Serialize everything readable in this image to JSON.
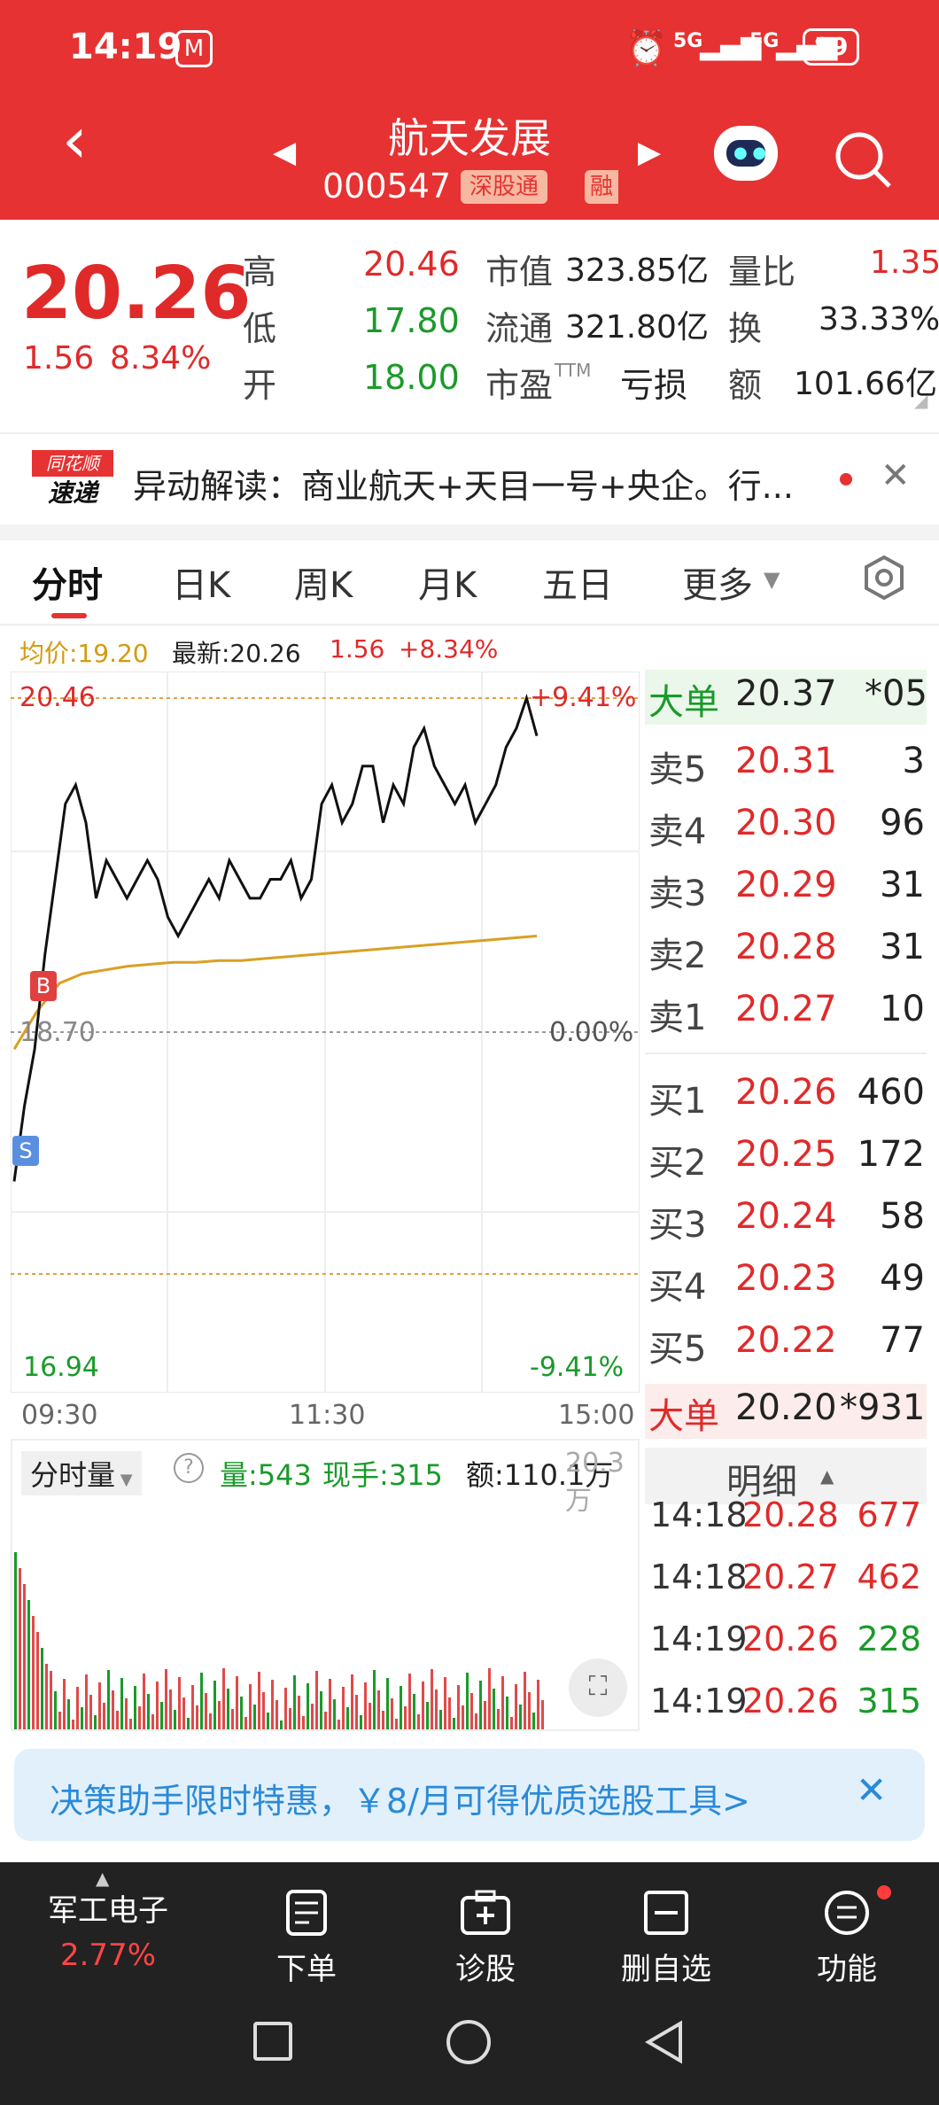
{
  "status": {
    "time": "14:19",
    "signal1": "5G",
    "signal2": "5G",
    "battery": "89"
  },
  "header": {
    "title": "航天发展",
    "code": "000547",
    "badge1": "深股通",
    "badge2": "融"
  },
  "quote": {
    "price": "20.26",
    "change": "1.56",
    "change_pct": "8.34%",
    "high_label": "高",
    "high": "20.46",
    "low_label": "低",
    "low": "17.80",
    "open_label": "开",
    "open": "18.00",
    "mktcap_label": "市值",
    "mktcap": "323.85亿",
    "float_label": "流通",
    "float": "321.80亿",
    "pe_label": "市盈",
    "pe_tm": "TTM",
    "pe": "亏损",
    "volratio_label": "量比",
    "volratio": "1.35",
    "turnover_label": "换",
    "turnover": "33.33%",
    "amount_label": "额",
    "amount": "101.66亿"
  },
  "news": {
    "brand1": "同花顺",
    "brand2": "速递",
    "text": "异动解读：商业航天+天目一号+央企。行..."
  },
  "tabs": [
    "分时",
    "日K",
    "周K",
    "月K",
    "五日",
    "更多"
  ],
  "chart_info": {
    "avg": "均价:19.20",
    "latest": "最新:20.26",
    "chg": "1.56",
    "pct": "+8.34%"
  },
  "chart_labels": {
    "top_price": "20.46",
    "top_pct": "+9.41%",
    "mid_price": "18.70",
    "mid_pct": "0.00%",
    "bot_price": "16.94",
    "bot_pct": "-9.41%",
    "t1": "09:30",
    "t2": "11:30",
    "t3": "15:00",
    "b_marker": "B",
    "s_marker": "S"
  },
  "vol_info": {
    "label": "分时量",
    "vol": "量:543",
    "hand": "现手:315",
    "amt": "额:110.1万",
    "overlay": "20.3万"
  },
  "orderbook": {
    "big_top": {
      "label": "大单",
      "price": "20.37",
      "vol": "*05"
    },
    "asks": [
      {
        "label": "卖5",
        "price": "20.31",
        "vol": "3"
      },
      {
        "label": "卖4",
        "price": "20.30",
        "vol": "96"
      },
      {
        "label": "卖3",
        "price": "20.29",
        "vol": "31"
      },
      {
        "label": "卖2",
        "price": "20.28",
        "vol": "31"
      },
      {
        "label": "卖1",
        "price": "20.27",
        "vol": "10"
      }
    ],
    "bids": [
      {
        "label": "买1",
        "price": "20.26",
        "vol": "460"
      },
      {
        "label": "买2",
        "price": "20.25",
        "vol": "172"
      },
      {
        "label": "买3",
        "price": "20.24",
        "vol": "58"
      },
      {
        "label": "买4",
        "price": "20.23",
        "vol": "49"
      },
      {
        "label": "买5",
        "price": "20.22",
        "vol": "77"
      }
    ],
    "big_bot": {
      "label": "大单",
      "price": "20.20",
      "vol": "*931"
    },
    "detail_label": "明细",
    "ticks": [
      {
        "time": "14:18",
        "price": "20.28",
        "vol": "677"
      },
      {
        "time": "14:18",
        "price": "20.27",
        "vol": "462"
      },
      {
        "time": "14:19",
        "price": "20.26",
        "vol": "228"
      },
      {
        "time": "14:19",
        "price": "20.26",
        "vol": "315"
      }
    ]
  },
  "promo": {
    "text": "决策助手限时特惠，￥8/月可得优质选股工具>"
  },
  "nav": {
    "sector": "军工电子",
    "sector_pct": "2.77%",
    "order": "下单",
    "diag": "诊股",
    "remove": "删自选",
    "func": "功能"
  },
  "chart_data": {
    "type": "line",
    "series": [
      {
        "values": [
          17.9,
          18.3,
          18.6,
          19.1,
          19.5,
          19.9,
          20.0,
          19.8,
          19.4,
          19.6,
          19.5,
          19.4,
          19.5,
          19.6,
          19.5,
          19.3,
          19.2,
          19.3,
          19.4,
          19.5,
          19.4,
          19.6,
          19.5,
          19.4,
          19.4,
          19.5,
          19.5,
          19.6,
          19.4,
          19.5,
          19.9,
          20.0,
          19.8,
          19.9,
          20.1,
          20.1,
          19.8,
          20.0,
          19.9,
          20.2,
          20.3,
          20.1,
          20.0,
          19.9,
          20.0,
          19.8,
          19.9,
          20.0,
          20.2,
          20.3,
          20.46,
          20.26
        ]
      },
      {
        "values": [
          18.6,
          18.8,
          18.95,
          19.0,
          19.02,
          19.04,
          19.05,
          19.06,
          19.06,
          19.07,
          19.07,
          19.08,
          19.09,
          19.1,
          19.11,
          19.12,
          19.13,
          19.14,
          19.15,
          19.16,
          19.17,
          19.18,
          19.19,
          19.2
        ]
      }
    ],
    "ylim": [
      16.94,
      20.46
    ]
  }
}
